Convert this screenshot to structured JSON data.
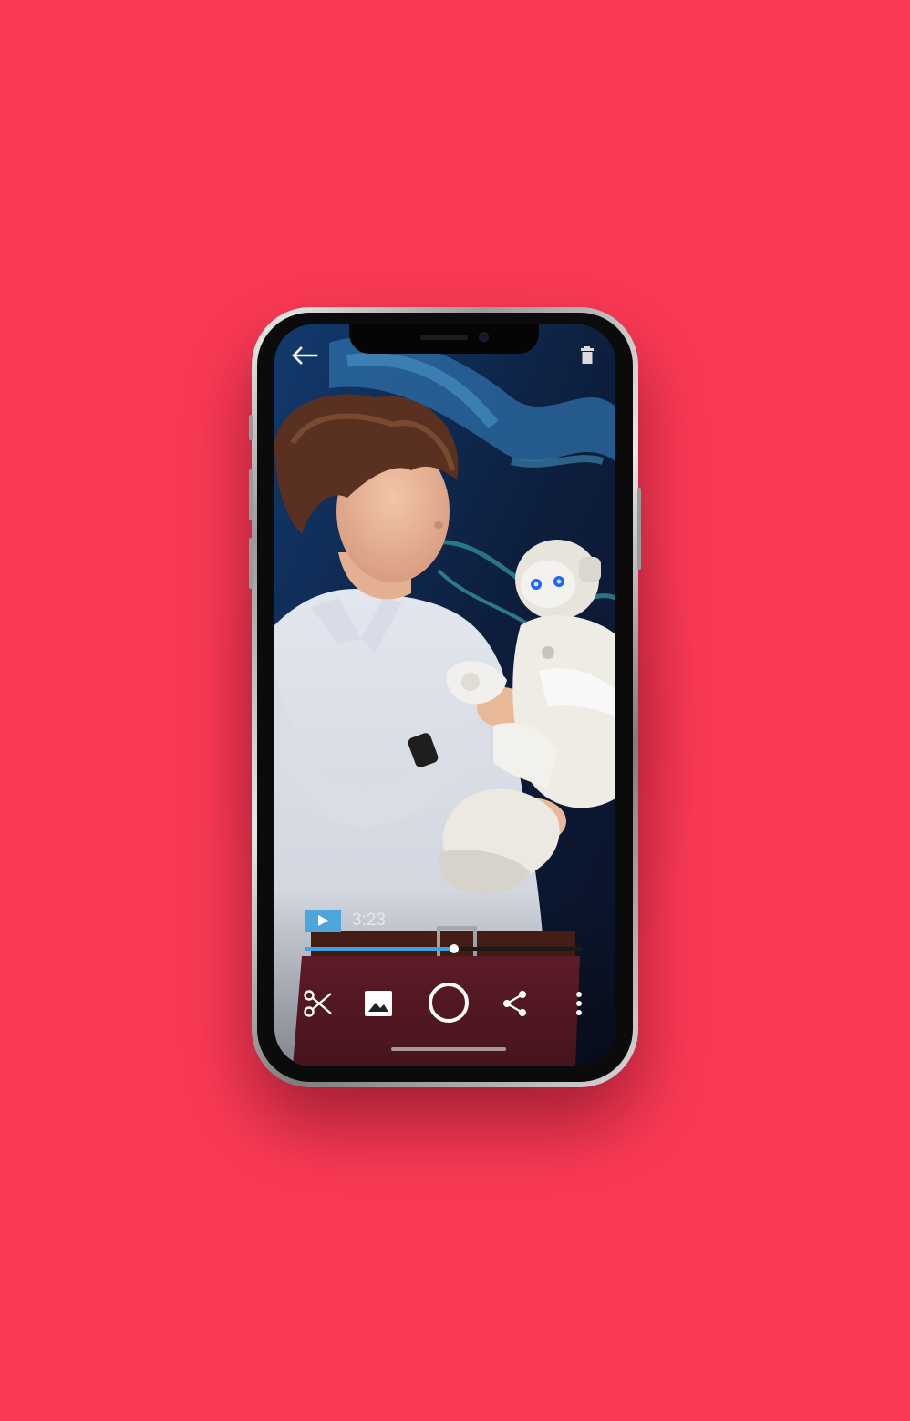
{
  "page": {
    "background_color": "#fb3a55"
  },
  "header": {
    "back_icon": "arrow-left-icon",
    "delete_icon": "trash-icon"
  },
  "player": {
    "play_icon": "play-icon",
    "time": "3:23",
    "progress": 0.54,
    "accent_color": "#3aa3e0"
  },
  "toolbar": {
    "items": [
      {
        "icon": "scissors-icon"
      },
      {
        "icon": "image-icon"
      },
      {
        "icon": "record-icon"
      },
      {
        "icon": "share-icon"
      },
      {
        "icon": "more-vertical-icon"
      }
    ]
  }
}
